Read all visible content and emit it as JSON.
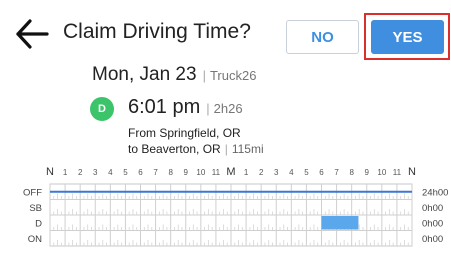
{
  "header": {
    "title": "Claim Driving Time?",
    "back_icon": "arrow-left-icon",
    "no_label": "NO",
    "yes_label": "YES"
  },
  "event": {
    "date": "Mon, Jan 23",
    "separator": "|",
    "truck": "Truck26",
    "status_letter": "D",
    "time": "6:01 pm",
    "duration": "2h26",
    "from": "From Springfield, OR",
    "to": "to Beaverton, OR",
    "distance": "115mi"
  },
  "log_grid": {
    "hour_labels": [
      "N",
      "1",
      "2",
      "3",
      "4",
      "5",
      "6",
      "7",
      "8",
      "9",
      "10",
      "11",
      "M",
      "1",
      "2",
      "3",
      "4",
      "5",
      "6",
      "7",
      "8",
      "9",
      "10",
      "11",
      "N"
    ],
    "rows": [
      {
        "label": "OFF",
        "total": "24h00"
      },
      {
        "label": "SB",
        "total": "0h00"
      },
      {
        "label": "D",
        "total": "0h00"
      },
      {
        "label": "ON",
        "total": "0h00"
      }
    ],
    "duty_line_row": "OFF",
    "claim_segment": {
      "row": "D",
      "start_hour": 18.0,
      "end_hour": 20.45
    }
  },
  "colors": {
    "accent": "#3f8ee0",
    "status_green": "#3cc46a",
    "highlight_red": "#d9302c",
    "claim_fill": "#5aa7ec",
    "duty_line": "#3b78d6"
  }
}
